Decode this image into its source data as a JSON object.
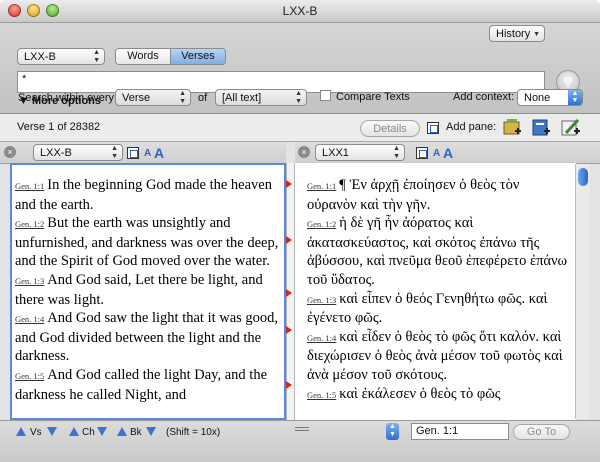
{
  "window": {
    "title": "LXX-B"
  },
  "toolbar": {
    "module_select": "LXX-B",
    "view_tabs": [
      "Words",
      "Verses"
    ],
    "history_label": "History",
    "search_value": "*",
    "more_options_label": "More options",
    "search_within_label": "Search within every",
    "search_unit": "Verse",
    "of_label": "of",
    "range_value": "[All text]",
    "compare_label": "Compare Texts",
    "add_context_label": "Add context:",
    "context_value": "None"
  },
  "infobar": {
    "verse_position": "Verse  1  of 28382",
    "details_label": "Details",
    "add_pane_label": "Add pane:"
  },
  "left_pane": {
    "module": "LXX-B",
    "verses": [
      {
        "ref": "Gen. 1:1",
        "text": "In the beginning God made the heaven and the earth."
      },
      {
        "ref": "Gen. 1:2",
        "text": "But the earth was unsightly and unfurnished, and darkness was over the deep, and the Spirit of God moved over the water."
      },
      {
        "ref": "Gen. 1:3",
        "text": "And God said, Let there be light, and there was light."
      },
      {
        "ref": "Gen. 1:4",
        "text": "And God saw the light that it was good, and God divided between the light and the darkness."
      },
      {
        "ref": "Gen. 1:5",
        "text": "And God called the light Day, and the darkness he called Night, and"
      }
    ]
  },
  "right_pane": {
    "module": "LXX1",
    "verses": [
      {
        "ref": "Gen. 1:1",
        "text": "¶  Ἐν ἀρχῇ ἐποίησεν ὁ θεὸς τὸν οὐρανὸν καὶ τὴν γῆν."
      },
      {
        "ref": "Gen. 1:2",
        "text": "ἡ δὲ γῆ ἦν ἀόρατος καὶ ἀκατασκεύαστος, καὶ σκότος ἐπάνω τῆς ἀβύσσου, καὶ πνεῦμα θεοῦ ἐπεφέρετο ἐπάνω τοῦ ὕδατος."
      },
      {
        "ref": "Gen. 1:3",
        "text": "καὶ εἶπεν ὁ θεός Γενηθήτω φῶς. καὶ ἐγένετο φῶς."
      },
      {
        "ref": "Gen. 1:4",
        "text": "καὶ εἶδεν ὁ θεὸς τὸ φῶς ὅτι καλόν. καὶ διεχώρισεν ὁ θεὸς ἀνὰ μέσον τοῦ φωτὸς καὶ ἀνὰ μέσον τοῦ σκότους."
      },
      {
        "ref": "Gen. 1:5",
        "text": "καὶ ἐκάλεσεν ὁ θεὸς τὸ φῶς"
      }
    ]
  },
  "bottombar": {
    "vs_label": "Vs",
    "ch_label": "Ch",
    "bk_label": "Bk",
    "shift_hint": "(Shift = 10x)",
    "goto_value": "Gen. 1:1",
    "goto_button": "Go To"
  }
}
